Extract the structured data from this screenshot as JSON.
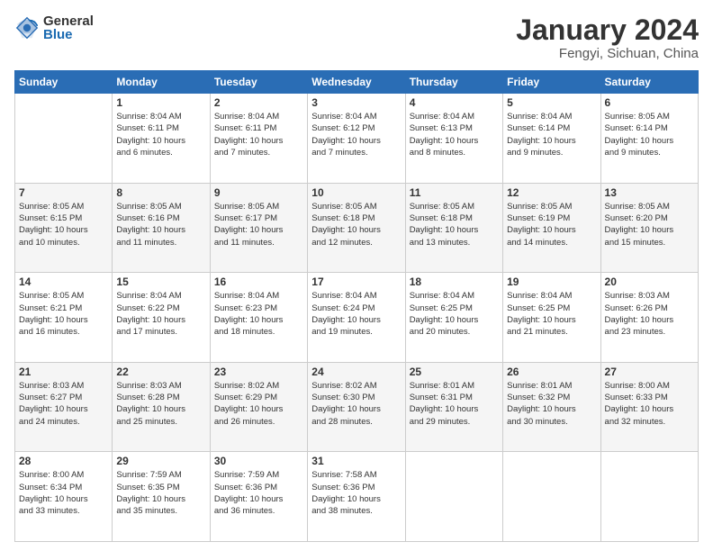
{
  "header": {
    "logo_general": "General",
    "logo_blue": "Blue",
    "title": "January 2024",
    "subtitle": "Fengyi, Sichuan, China"
  },
  "weekdays": [
    "Sunday",
    "Monday",
    "Tuesday",
    "Wednesday",
    "Thursday",
    "Friday",
    "Saturday"
  ],
  "weeks": [
    [
      {
        "day": "",
        "info": ""
      },
      {
        "day": "1",
        "info": "Sunrise: 8:04 AM\nSunset: 6:11 PM\nDaylight: 10 hours\nand 6 minutes."
      },
      {
        "day": "2",
        "info": "Sunrise: 8:04 AM\nSunset: 6:11 PM\nDaylight: 10 hours\nand 7 minutes."
      },
      {
        "day": "3",
        "info": "Sunrise: 8:04 AM\nSunset: 6:12 PM\nDaylight: 10 hours\nand 7 minutes."
      },
      {
        "day": "4",
        "info": "Sunrise: 8:04 AM\nSunset: 6:13 PM\nDaylight: 10 hours\nand 8 minutes."
      },
      {
        "day": "5",
        "info": "Sunrise: 8:04 AM\nSunset: 6:14 PM\nDaylight: 10 hours\nand 9 minutes."
      },
      {
        "day": "6",
        "info": "Sunrise: 8:05 AM\nSunset: 6:14 PM\nDaylight: 10 hours\nand 9 minutes."
      }
    ],
    [
      {
        "day": "7",
        "info": "Sunrise: 8:05 AM\nSunset: 6:15 PM\nDaylight: 10 hours\nand 10 minutes."
      },
      {
        "day": "8",
        "info": "Sunrise: 8:05 AM\nSunset: 6:16 PM\nDaylight: 10 hours\nand 11 minutes."
      },
      {
        "day": "9",
        "info": "Sunrise: 8:05 AM\nSunset: 6:17 PM\nDaylight: 10 hours\nand 11 minutes."
      },
      {
        "day": "10",
        "info": "Sunrise: 8:05 AM\nSunset: 6:18 PM\nDaylight: 10 hours\nand 12 minutes."
      },
      {
        "day": "11",
        "info": "Sunrise: 8:05 AM\nSunset: 6:18 PM\nDaylight: 10 hours\nand 13 minutes."
      },
      {
        "day": "12",
        "info": "Sunrise: 8:05 AM\nSunset: 6:19 PM\nDaylight: 10 hours\nand 14 minutes."
      },
      {
        "day": "13",
        "info": "Sunrise: 8:05 AM\nSunset: 6:20 PM\nDaylight: 10 hours\nand 15 minutes."
      }
    ],
    [
      {
        "day": "14",
        "info": "Sunrise: 8:05 AM\nSunset: 6:21 PM\nDaylight: 10 hours\nand 16 minutes."
      },
      {
        "day": "15",
        "info": "Sunrise: 8:04 AM\nSunset: 6:22 PM\nDaylight: 10 hours\nand 17 minutes."
      },
      {
        "day": "16",
        "info": "Sunrise: 8:04 AM\nSunset: 6:23 PM\nDaylight: 10 hours\nand 18 minutes."
      },
      {
        "day": "17",
        "info": "Sunrise: 8:04 AM\nSunset: 6:24 PM\nDaylight: 10 hours\nand 19 minutes."
      },
      {
        "day": "18",
        "info": "Sunrise: 8:04 AM\nSunset: 6:25 PM\nDaylight: 10 hours\nand 20 minutes."
      },
      {
        "day": "19",
        "info": "Sunrise: 8:04 AM\nSunset: 6:25 PM\nDaylight: 10 hours\nand 21 minutes."
      },
      {
        "day": "20",
        "info": "Sunrise: 8:03 AM\nSunset: 6:26 PM\nDaylight: 10 hours\nand 23 minutes."
      }
    ],
    [
      {
        "day": "21",
        "info": "Sunrise: 8:03 AM\nSunset: 6:27 PM\nDaylight: 10 hours\nand 24 minutes."
      },
      {
        "day": "22",
        "info": "Sunrise: 8:03 AM\nSunset: 6:28 PM\nDaylight: 10 hours\nand 25 minutes."
      },
      {
        "day": "23",
        "info": "Sunrise: 8:02 AM\nSunset: 6:29 PM\nDaylight: 10 hours\nand 26 minutes."
      },
      {
        "day": "24",
        "info": "Sunrise: 8:02 AM\nSunset: 6:30 PM\nDaylight: 10 hours\nand 28 minutes."
      },
      {
        "day": "25",
        "info": "Sunrise: 8:01 AM\nSunset: 6:31 PM\nDaylight: 10 hours\nand 29 minutes."
      },
      {
        "day": "26",
        "info": "Sunrise: 8:01 AM\nSunset: 6:32 PM\nDaylight: 10 hours\nand 30 minutes."
      },
      {
        "day": "27",
        "info": "Sunrise: 8:00 AM\nSunset: 6:33 PM\nDaylight: 10 hours\nand 32 minutes."
      }
    ],
    [
      {
        "day": "28",
        "info": "Sunrise: 8:00 AM\nSunset: 6:34 PM\nDaylight: 10 hours\nand 33 minutes."
      },
      {
        "day": "29",
        "info": "Sunrise: 7:59 AM\nSunset: 6:35 PM\nDaylight: 10 hours\nand 35 minutes."
      },
      {
        "day": "30",
        "info": "Sunrise: 7:59 AM\nSunset: 6:36 PM\nDaylight: 10 hours\nand 36 minutes."
      },
      {
        "day": "31",
        "info": "Sunrise: 7:58 AM\nSunset: 6:36 PM\nDaylight: 10 hours\nand 38 minutes."
      },
      {
        "day": "",
        "info": ""
      },
      {
        "day": "",
        "info": ""
      },
      {
        "day": "",
        "info": ""
      }
    ]
  ]
}
